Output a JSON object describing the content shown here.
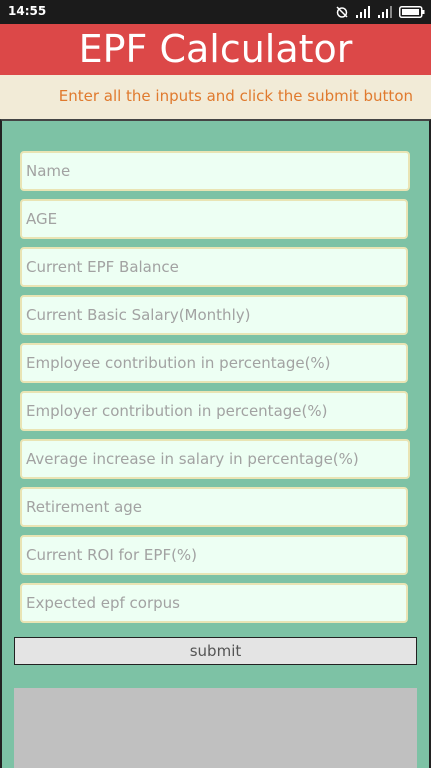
{
  "status_bar": {
    "time": "14:55",
    "icons": [
      "alarm-off-icon",
      "signal-icon",
      "signal-icon",
      "battery-icon"
    ]
  },
  "app": {
    "title": "EPF Calculator",
    "instruction": "Enter all the inputs and click the submit button"
  },
  "form": {
    "fields": [
      {
        "id": "name",
        "placeholder": "Name",
        "value": ""
      },
      {
        "id": "age",
        "placeholder": "AGE",
        "value": ""
      },
      {
        "id": "epf_balance",
        "placeholder": "Current EPF Balance",
        "value": ""
      },
      {
        "id": "basic_salary",
        "placeholder": "Current Basic Salary(Monthly)",
        "value": ""
      },
      {
        "id": "employee_contribution",
        "placeholder": "Employee contribution in percentage(%)",
        "value": ""
      },
      {
        "id": "employer_contribution",
        "placeholder": "Employer contribution in percentage(%)",
        "value": ""
      },
      {
        "id": "salary_increase",
        "placeholder": "Average increase in salary in percentage(%)",
        "value": ""
      },
      {
        "id": "retirement_age",
        "placeholder": "Retirement age",
        "value": ""
      },
      {
        "id": "roi",
        "placeholder": "Current ROI for EPF(%)",
        "value": ""
      },
      {
        "id": "expected_corpus",
        "placeholder": "Expected epf corpus",
        "value": ""
      }
    ],
    "submit_label": "submit"
  },
  "colors": {
    "title_bar": "#dc4848",
    "instruction_text": "#e07a2e",
    "form_background": "#7dc2a5",
    "field_background": "#edfff3"
  }
}
